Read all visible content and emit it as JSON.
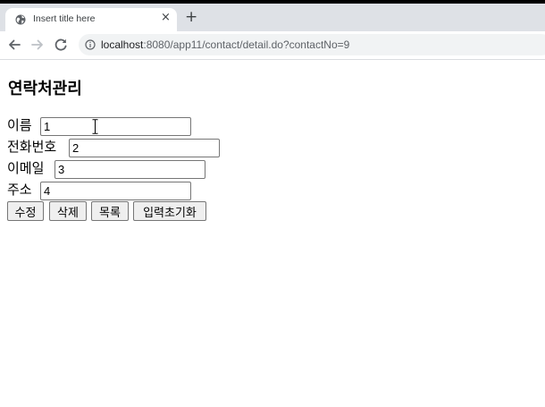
{
  "browser": {
    "tab": {
      "title": "Insert title here",
      "close": "×"
    },
    "new_tab": "+",
    "address": {
      "host": "localhost",
      "rest": ":8080/app11/contact/detail.do?contactNo=9"
    },
    "icons": {
      "tab": "globe-icon",
      "back": "arrow-left-icon",
      "forward": "arrow-right-icon",
      "reload": "reload-icon",
      "info": "info-icon"
    }
  },
  "page": {
    "title": "연락처관리",
    "fields": [
      {
        "label": "이름",
        "value": "1"
      },
      {
        "label": "전화번호",
        "value": "2"
      },
      {
        "label": "이메일",
        "value": "3"
      },
      {
        "label": "주소",
        "value": "4"
      }
    ],
    "buttons": {
      "update": "수정",
      "delete": "삭제",
      "list": "목록",
      "reset": "입력초기화"
    }
  },
  "colors": {
    "tab_bar": "#dee1e6",
    "omnibox": "#f1f3f4",
    "button": "#efefef",
    "input_border": "#767676"
  }
}
